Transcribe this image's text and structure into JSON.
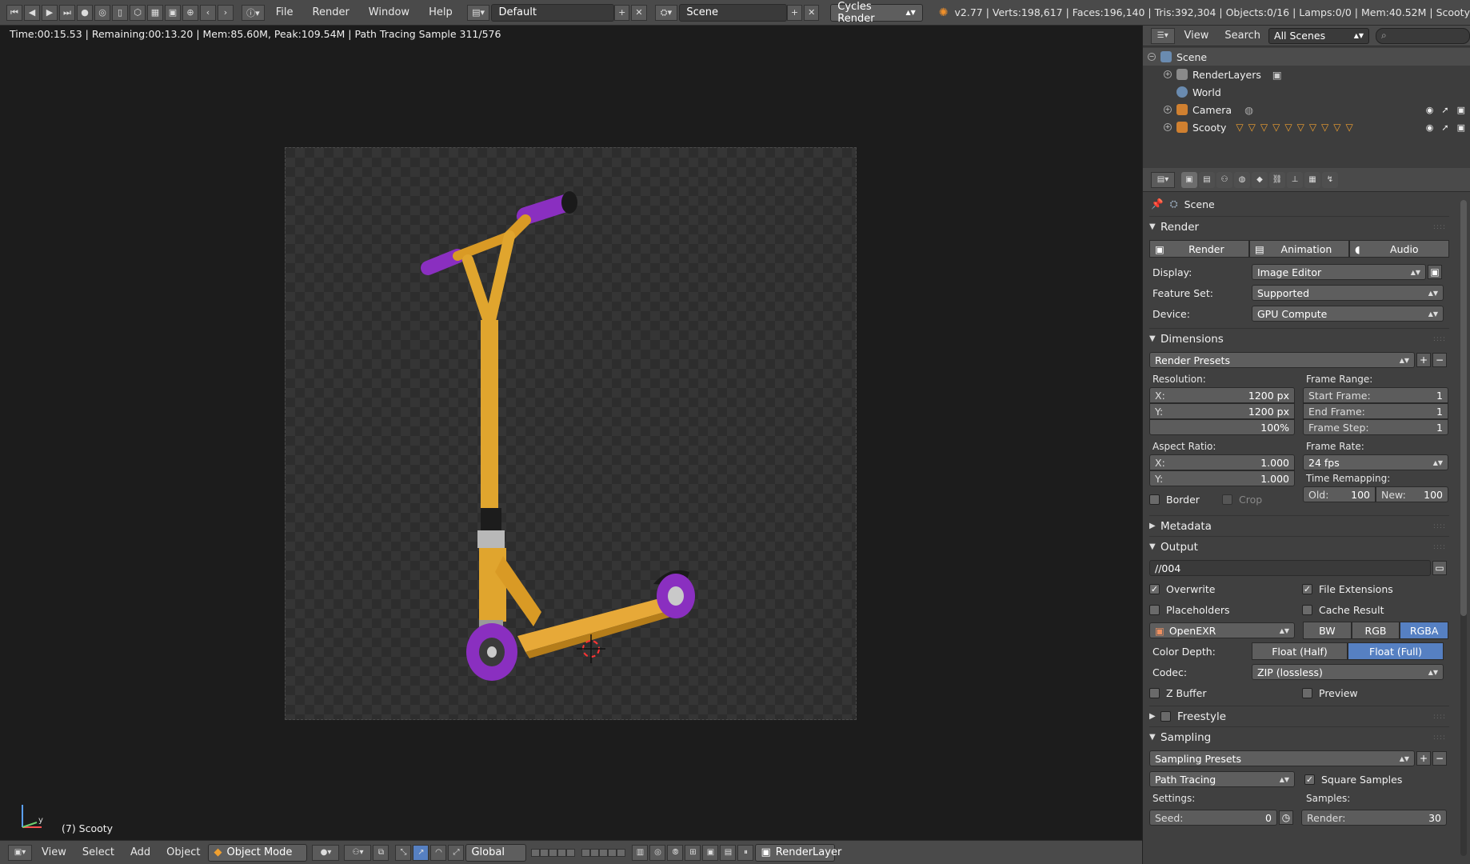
{
  "topbar": {
    "menus": [
      "File",
      "Render",
      "Window",
      "Help"
    ],
    "screen_layout": "Default",
    "scene": "Scene",
    "engine": "Cycles Render",
    "stats": "v2.77 | Verts:198,617 | Faces:196,140 | Tris:392,304 | Objects:0/16 | Lamps:0/0 | Mem:40.52M | Scooty"
  },
  "viewport": {
    "status": "Time:00:15.53 | Remaining:00:13.20 | Mem:85.60M, Peak:109.54M | Path Tracing Sample 311/576",
    "object_label": "(7) Scooty",
    "axis_y": "y"
  },
  "bottombar": {
    "menus": [
      "View",
      "Select",
      "Add",
      "Object"
    ],
    "mode": "Object Mode",
    "orientation": "Global",
    "render_layer": "RenderLayer"
  },
  "outliner": {
    "menus": [
      "View",
      "Search"
    ],
    "filter": "All Scenes",
    "items": [
      {
        "label": "Scene"
      },
      {
        "label": "RenderLayers"
      },
      {
        "label": "World"
      },
      {
        "label": "Camera"
      },
      {
        "label": "Scooty"
      }
    ]
  },
  "properties": {
    "breadcrumb": "Scene",
    "render": {
      "title": "Render",
      "buttons": [
        "Render",
        "Animation",
        "Audio"
      ],
      "display_label": "Display:",
      "display": "Image Editor",
      "feature_label": "Feature Set:",
      "feature": "Supported",
      "device_label": "Device:",
      "device": "GPU Compute"
    },
    "dimensions": {
      "title": "Dimensions",
      "presets": "Render Presets",
      "resolution_label": "Resolution:",
      "res_x_key": "X:",
      "res_x": "1200 px",
      "res_y_key": "Y:",
      "res_y": "1200 px",
      "res_pct": "100%",
      "aspect_label": "Aspect Ratio:",
      "asp_x_key": "X:",
      "asp_x": "1.000",
      "asp_y_key": "Y:",
      "asp_y": "1.000",
      "border": "Border",
      "crop": "Crop",
      "frame_range_label": "Frame Range:",
      "start_key": "Start Frame:",
      "start": "1",
      "end_key": "End Frame:",
      "end": "1",
      "step_key": "Frame Step:",
      "step": "1",
      "frame_rate_label": "Frame Rate:",
      "fps": "24 fps",
      "remap_label": "Time Remapping:",
      "old_key": "Old:",
      "old": "100",
      "new_key": "New:",
      "new": "100"
    },
    "metadata": {
      "title": "Metadata"
    },
    "output": {
      "title": "Output",
      "path": "//004",
      "overwrite": "Overwrite",
      "file_ext": "File Extensions",
      "placeholders": "Placeholders",
      "cache": "Cache Result",
      "format": "OpenEXR",
      "color_modes": [
        "BW",
        "RGB",
        "RGBA"
      ],
      "depth_label": "Color Depth:",
      "depths": [
        "Float (Half)",
        "Float (Full)"
      ],
      "codec_label": "Codec:",
      "codec": "ZIP (lossless)",
      "zbuffer": "Z Buffer",
      "preview": "Preview"
    },
    "freestyle": {
      "title": "Freestyle"
    },
    "sampling": {
      "title": "Sampling",
      "presets": "Sampling Presets",
      "method": "Path Tracing",
      "square": "Square Samples",
      "settings_label": "Settings:",
      "samples_label": "Samples:",
      "seed_key": "Seed:",
      "seed": "0",
      "render_key": "Render:",
      "render_samples": "30"
    }
  },
  "colors": {
    "accent_blue": "#5680c2",
    "scooter_yellow": "#e0a52e",
    "scooter_purple": "#8a2fc0"
  }
}
